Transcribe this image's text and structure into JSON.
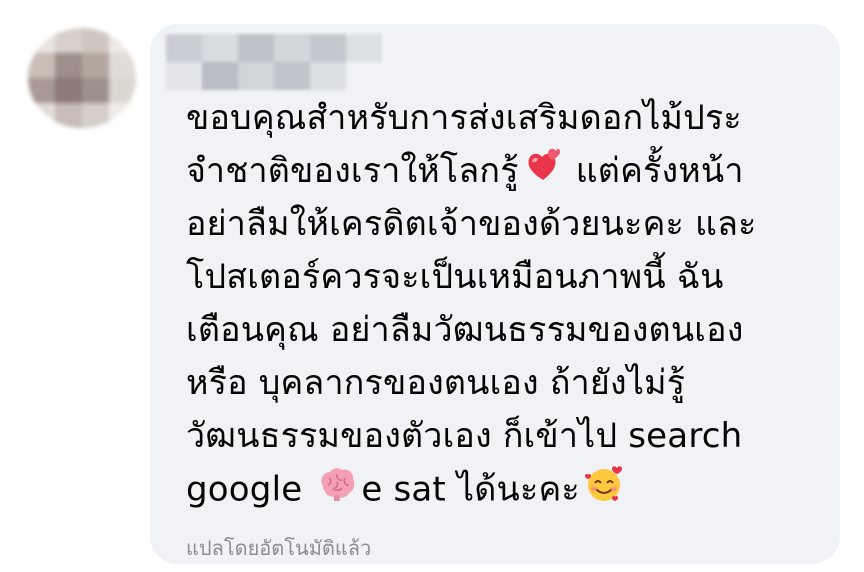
{
  "comment": {
    "lines": [
      "ขอบคุณสำหรับการส่งเสริมดอกไม้ประ",
      "จำชาติของเราให้โลกรู้",
      "แต่ครั้งหน้า",
      "อย่าลืมให้เครดิตเจ้าของด้วยนะคะ และ",
      "โปสเตอร์ควรจะเป็นเหมือนภาพนี้ ฉัน",
      "เตือนคุณ อย่าลืมวัฒนธรรมของตนเอง",
      "หรือ บุคลากรของตนเอง ถ้ายังไม่รู้",
      "วัฒนธรรมของตัวเอง ก็เข้าไป search",
      "google",
      "e sat ได้นะคะ"
    ],
    "emojis": {
      "hearts": "two-hearts-icon",
      "brain": "brain-icon",
      "smile": "smiling-face-with-hearts-icon"
    }
  },
  "footer": {
    "translated_label": "แปลโดยอัตโนมัติแล้ว"
  },
  "colors": {
    "bubble": "#f0f2f5",
    "text": "#050505",
    "muted": "#8a8d91"
  }
}
